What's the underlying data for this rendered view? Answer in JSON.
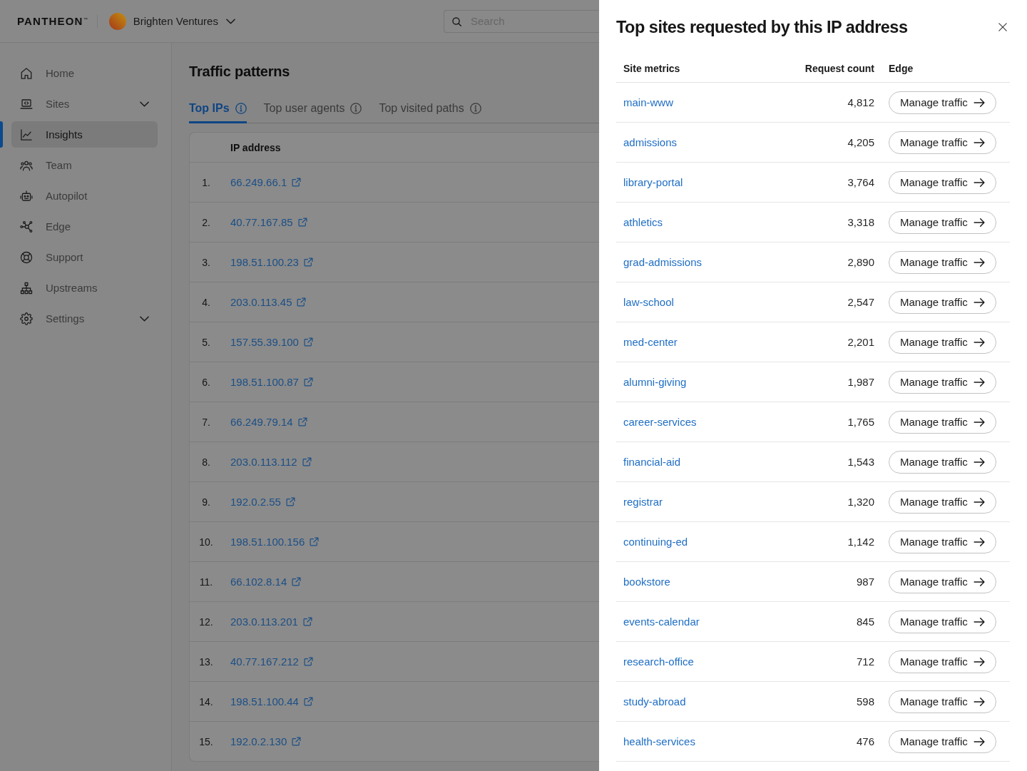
{
  "header": {
    "logo": "PANTHEON$^{™}$",
    "org": {
      "name": "Brighten Ventures"
    },
    "search": {
      "placeholder": "Search"
    }
  },
  "sidebar": {
    "items": [
      {
        "label": "Home",
        "kind": "link",
        "selected": false
      },
      {
        "label": "Sites",
        "kind": "group",
        "selected": false
      },
      {
        "label": "Insights",
        "kind": "link",
        "selected": true
      },
      {
        "label": "Team",
        "kind": "link",
        "selected": false
      },
      {
        "label": "Autopilot",
        "kind": "link",
        "selected": false
      },
      {
        "label": "Edge",
        "kind": "link",
        "selected": false
      },
      {
        "label": "Support",
        "kind": "link",
        "selected": false
      },
      {
        "label": "Upstreams",
        "kind": "link",
        "selected": false
      },
      {
        "label": "Settings",
        "kind": "group",
        "selected": false
      }
    ]
  },
  "page": {
    "title": "Traffic patterns",
    "tabs": [
      {
        "label": "Top IPs",
        "selected": true
      },
      {
        "label": "Top user agents",
        "selected": false
      },
      {
        "label": "Top visited paths",
        "selected": false
      }
    ],
    "table": {
      "columns": [
        "IP address"
      ],
      "rows": [
        {
          "rank": "1.",
          "ip": "66.249.66.1"
        },
        {
          "rank": "2.",
          "ip": "40.77.167.85"
        },
        {
          "rank": "3.",
          "ip": "198.51.100.23"
        },
        {
          "rank": "4.",
          "ip": "203.0.113.45"
        },
        {
          "rank": "5.",
          "ip": "157.55.39.100"
        },
        {
          "rank": "6.",
          "ip": "198.51.100.87"
        },
        {
          "rank": "7.",
          "ip": "66.249.79.14"
        },
        {
          "rank": "8.",
          "ip": "203.0.113.112"
        },
        {
          "rank": "9.",
          "ip": "192.0.2.55"
        },
        {
          "rank": "10.",
          "ip": "198.51.100.156"
        },
        {
          "rank": "11.",
          "ip": "66.102.8.14"
        },
        {
          "rank": "12.",
          "ip": "203.0.113.201"
        },
        {
          "rank": "13.",
          "ip": "40.77.167.212"
        },
        {
          "rank": "14.",
          "ip": "198.51.100.44"
        },
        {
          "rank": "15.",
          "ip": "192.0.2.130"
        }
      ]
    }
  },
  "drawer": {
    "title": "Top sites requested by this IP address",
    "table": {
      "columns": [
        "Site metrics",
        "Request count",
        "Edge"
      ],
      "rows": [
        {
          "site": "main-www",
          "requests": "4,812",
          "action": "Manage traffic"
        },
        {
          "site": "admissions",
          "requests": "4,205",
          "action": "Manage traffic"
        },
        {
          "site": "library-portal",
          "requests": "3,764",
          "action": "Manage traffic"
        },
        {
          "site": "athletics",
          "requests": "3,318",
          "action": "Manage traffic"
        },
        {
          "site": "grad-admissions",
          "requests": "2,890",
          "action": "Manage traffic"
        },
        {
          "site": "law-school",
          "requests": "2,547",
          "action": "Manage traffic"
        },
        {
          "site": "med-center",
          "requests": "2,201",
          "action": "Manage traffic"
        },
        {
          "site": "alumni-giving",
          "requests": "1,987",
          "action": "Manage traffic"
        },
        {
          "site": "career-services",
          "requests": "1,765",
          "action": "Manage traffic"
        },
        {
          "site": "financial-aid",
          "requests": "1,543",
          "action": "Manage traffic"
        },
        {
          "site": "registrar",
          "requests": "1,320",
          "action": "Manage traffic"
        },
        {
          "site": "continuing-ed",
          "requests": "1,142",
          "action": "Manage traffic"
        },
        {
          "site": "bookstore",
          "requests": "987",
          "action": "Manage traffic"
        },
        {
          "site": "events-calendar",
          "requests": "845",
          "action": "Manage traffic"
        },
        {
          "site": "research-office",
          "requests": "712",
          "action": "Manage traffic"
        },
        {
          "site": "study-abroad",
          "requests": "598",
          "action": "Manage traffic"
        },
        {
          "site": "health-services",
          "requests": "476",
          "action": "Manage traffic"
        }
      ]
    }
  }
}
